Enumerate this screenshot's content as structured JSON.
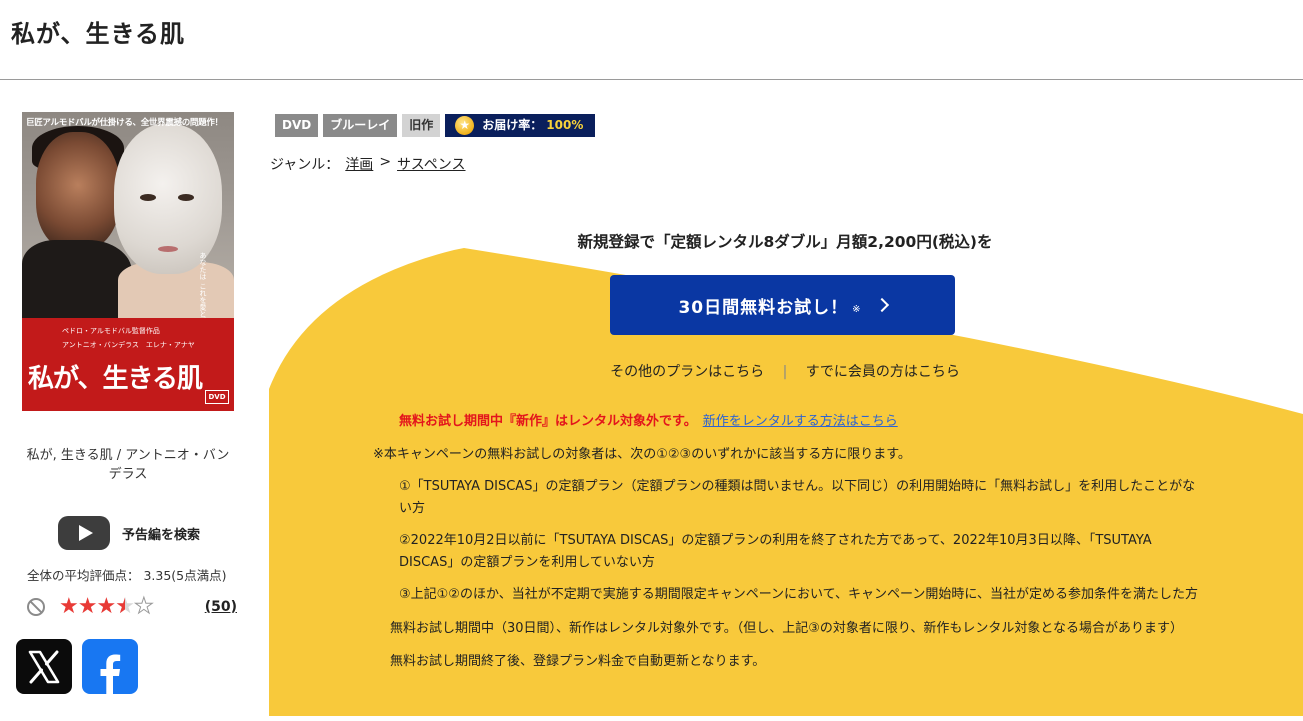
{
  "page": {
    "title": "私が、生きる肌"
  },
  "poster": {
    "tagline": "巨匠アルモドバルが仕掛ける、全世界震撼の問題作！",
    "vertical_copy": "あなたは これを愛と呼ぶか",
    "director_credit": "ペドロ・アルモドバル監督作品",
    "cast_credit": "アントニオ・バンデラス　エレナ・アナヤ",
    "film_title": "私が、生きる肌",
    "dvd_logo": "DVD"
  },
  "caption": "私が, 生きる肌 / アントニオ・バンデラス",
  "trailer": {
    "label": "予告編を検索"
  },
  "rating": {
    "summary": "全体の平均評価点： 3.35(5点満点)",
    "score": 3.35,
    "max": 5,
    "review_count": "(50)"
  },
  "share": {
    "x_label": "X",
    "facebook_label": "f"
  },
  "tags": [
    {
      "label": "DVD"
    },
    {
      "label": "ブルーレイ"
    },
    {
      "label": "旧作"
    }
  ],
  "delivery": {
    "label": "お届け率：",
    "value": "100%"
  },
  "genre": {
    "label": "ジャンル：",
    "items": [
      "洋画",
      "サスペンス"
    ],
    "separator": ">"
  },
  "promo": {
    "lead": "新規登録で「定額レンタル8ダブル」月額2,200円(税込)を",
    "button_label": "30日間無料お試し！",
    "button_note": "※",
    "other_plans": "その他のプランはこちら",
    "link_separator": "|",
    "member_login": "すでに会員の方はこちら",
    "warning": "無料お試し期間中『新作』はレンタル対象外です。",
    "warning_link": "新作をレンタルする方法はこちら",
    "notes": {
      "intro": "※本キャンペーンの無料お試しの対象者は、次の①②③のいずれかに該当する方に限ります。",
      "item1": "①「TSUTAYA DISCAS」の定額プラン（定額プランの種類は問いません。以下同じ）の利用開始時に「無料お試し」を利用したことがない方",
      "item2": "②2022年10月2日以前に「TSUTAYA DISCAS」の定額プランの利用を終了された方であって、2022年10月3日以降、「TSUTAYA DISCAS」の定額プランを利用していない方",
      "item3": "③上記①②のほか、当社が不定期で実施する期間限定キャンペーンにおいて、キャンペーン開始時に、当社が定める参加条件を満たした方",
      "trial_period": "無料お試し期間中（30日間）、新作はレンタル対象外です。（但し、上記③の対象者に限り、新作もレンタル対象となる場合があります）",
      "auto_renew": "無料お試し期間終了後、登録プラン料金で自動更新となります。"
    }
  },
  "colors": {
    "promo_bg": "#f8c93b",
    "button_blue": "#0a37a3",
    "warning_red": "#e3151c",
    "link_blue": "#2d63d2"
  }
}
